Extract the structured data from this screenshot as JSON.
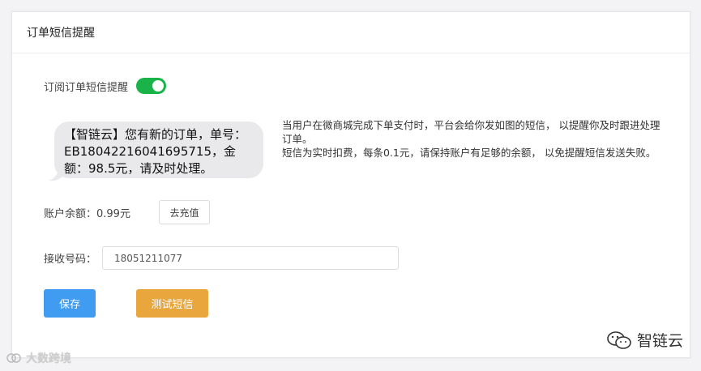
{
  "header": {
    "title": "订单短信提醒"
  },
  "subscribe": {
    "label": "订阅订单短信提醒",
    "enabled": true
  },
  "preview": {
    "message": "【智链云】您有新的订单，单号：EB18042216041695715，金额：98.5元，请及时处理。"
  },
  "notice": {
    "line1": "当用户在微商城完成下单支付时，平台会给你发如图的短信， 以提醒你及时跟进处理订单。",
    "line2": "短信为实时扣费，每条0.1元，请保持账户有足够的余额， 以免提醒短信发送失败。"
  },
  "balance": {
    "label": "账户余额：0.99元",
    "recharge_label": "去充值"
  },
  "phone": {
    "label": "接收号码：",
    "value": "18051211077"
  },
  "actions": {
    "save_label": "保存",
    "test_label": "测试短信"
  },
  "watermarks": {
    "left": "大数跨境",
    "right": "智链云"
  },
  "colors": {
    "toggle_on": "#1ab34a",
    "save": "#3f9cf0",
    "test": "#e8a63c"
  }
}
